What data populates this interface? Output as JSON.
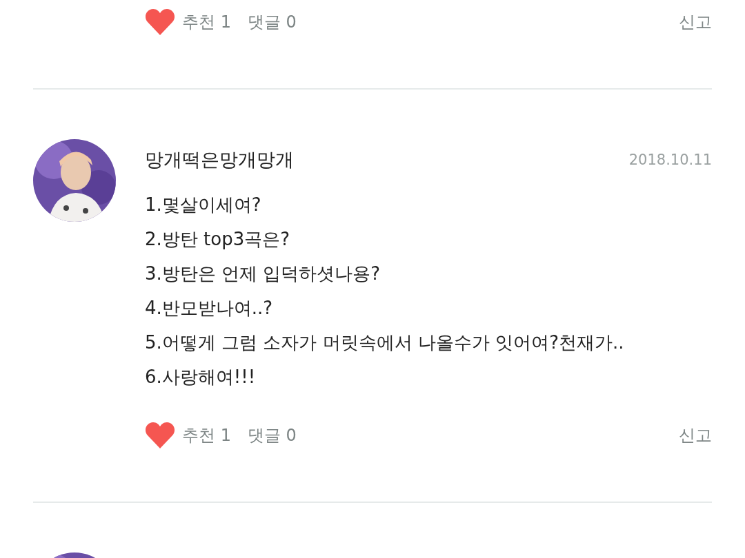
{
  "comments": [
    {
      "footer": {
        "like_label": "추천 1",
        "reply_label": "댓글 0",
        "report": "신고"
      }
    },
    {
      "avatar": {
        "kind": "picture"
      },
      "name": "망개떡은망개망개",
      "date": "2018.10.11",
      "lines": [
        "1.몇살이세여?",
        "2.방탄 top3곡은?",
        "3.방탄은 언제 입덕하셧나용?",
        "4.반모받나여..?",
        "5.어떻게 그럼 소자가 머릿속에서 나올수가 잇어여?천재가..",
        "6.사랑해여!!!"
      ],
      "footer": {
        "like_label": "추천 1",
        "reply_label": "댓글 0",
        "report": "신고"
      }
    },
    {
      "avatar": {
        "kind": "picture"
      }
    }
  ]
}
